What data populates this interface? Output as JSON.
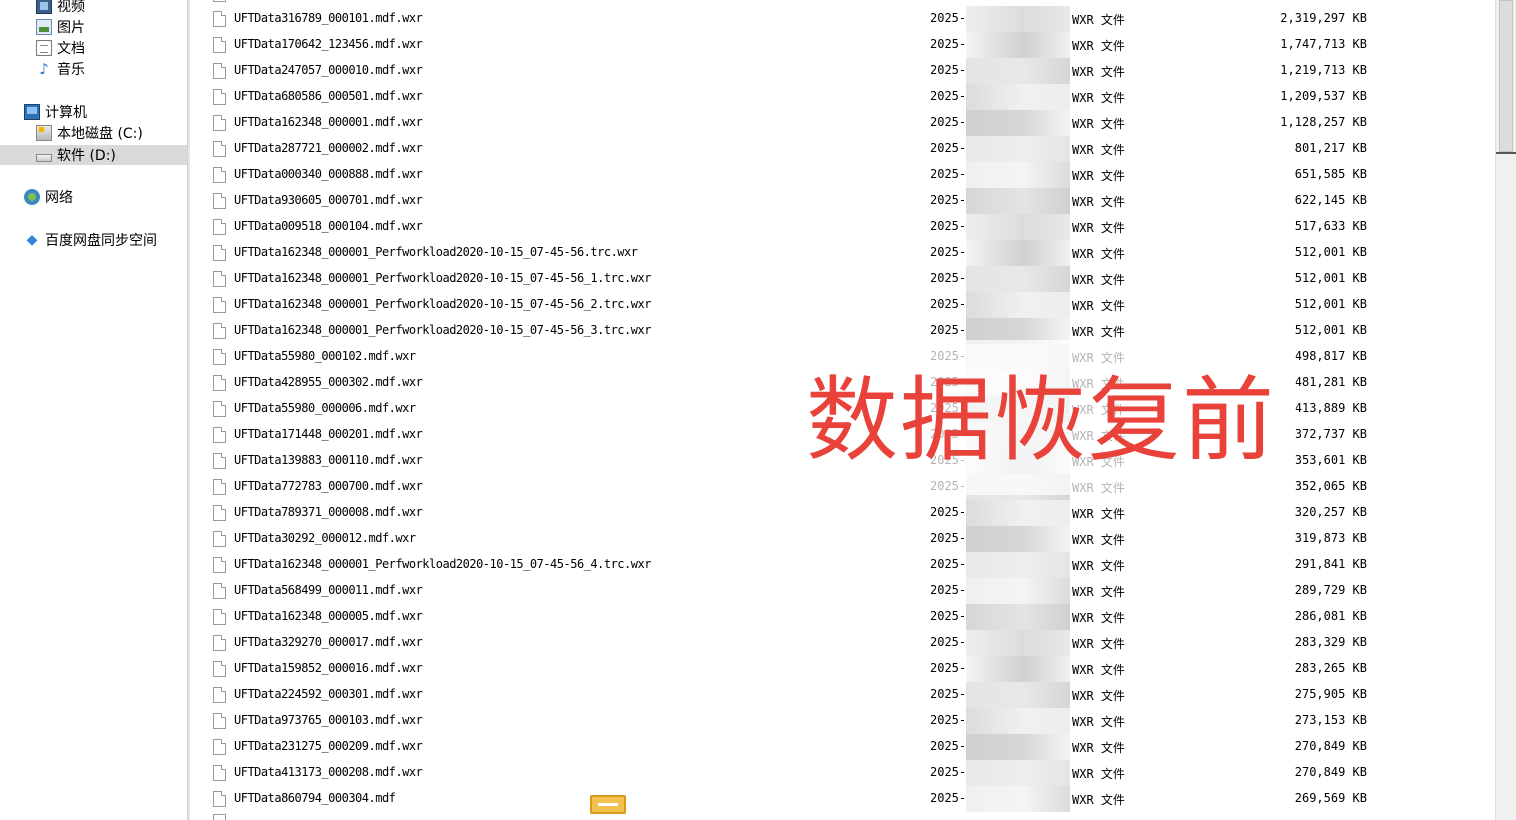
{
  "sidebar": {
    "libraries": [
      {
        "label": "视频",
        "icon": "video-icon"
      },
      {
        "label": "图片",
        "icon": "pictures-icon"
      },
      {
        "label": "文档",
        "icon": "documents-icon"
      },
      {
        "label": "音乐",
        "icon": "music-icon"
      }
    ],
    "computer": {
      "label": "计算机",
      "icon": "computer-icon"
    },
    "drives": [
      {
        "label": "本地磁盘 (C:)",
        "icon": "local-disk-icon"
      },
      {
        "label": "软件 (D:)",
        "icon": "drive-icon",
        "selected": true
      }
    ],
    "network": {
      "label": "网络",
      "icon": "network-icon"
    },
    "baidu": {
      "label": "百度网盘同步空间",
      "icon": "baidu-sync-icon"
    }
  },
  "files": [
    {
      "name": "UFTData316789_000101.mdf.wxr",
      "date": "2025-",
      "type": "WXR 文件",
      "size": "2,319,297 KB"
    },
    {
      "name": "UFTData170642_123456.mdf.wxr",
      "date": "2025-",
      "type": "WXR 文件",
      "size": "1,747,713 KB"
    },
    {
      "name": "UFTData247057_000010.mdf.wxr",
      "date": "2025-",
      "type": "WXR 文件",
      "size": "1,219,713 KB"
    },
    {
      "name": "UFTData680586_000501.mdf.wxr",
      "date": "2025-",
      "type": "WXR 文件",
      "size": "1,209,537 KB"
    },
    {
      "name": "UFTData162348_000001.mdf.wxr",
      "date": "2025-",
      "type": "WXR 文件",
      "size": "1,128,257 KB"
    },
    {
      "name": "UFTData287721_000002.mdf.wxr",
      "date": "2025-",
      "type": "WXR 文件",
      "size": "801,217 KB"
    },
    {
      "name": "UFTData000340_000888.mdf.wxr",
      "date": "2025-",
      "type": "WXR 文件",
      "size": "651,585 KB"
    },
    {
      "name": "UFTData930605_000701.mdf.wxr",
      "date": "2025-",
      "type": "WXR 文件",
      "size": "622,145 KB"
    },
    {
      "name": "UFTData009518_000104.mdf.wxr",
      "date": "2025-",
      "type": "WXR 文件",
      "size": "517,633 KB"
    },
    {
      "name": "UFTData162348_000001_Perfworkload2020-10-15_07-45-56.trc.wxr",
      "date": "2025-",
      "type": "WXR 文件",
      "size": "512,001 KB"
    },
    {
      "name": "UFTData162348_000001_Perfworkload2020-10-15_07-45-56_1.trc.wxr",
      "date": "2025-",
      "type": "WXR 文件",
      "size": "512,001 KB"
    },
    {
      "name": "UFTData162348_000001_Perfworkload2020-10-15_07-45-56_2.trc.wxr",
      "date": "2025-",
      "type": "WXR 文件",
      "size": "512,001 KB"
    },
    {
      "name": "UFTData162348_000001_Perfworkload2020-10-15_07-45-56_3.trc.wxr",
      "date": "2025-",
      "type": "WXR 文件",
      "size": "512,001 KB"
    },
    {
      "name": "UFTData55980_000102.mdf.wxr",
      "date": "2025-",
      "type": "WXR 文件",
      "size": "498,817 KB"
    },
    {
      "name": "UFTData428955_000302.mdf.wxr",
      "date": "2025-",
      "type": "WXR 文件",
      "size": "481,281 KB"
    },
    {
      "name": "UFTData55980_000006.mdf.wxr",
      "date": "2025-",
      "type": "WXR 文件",
      "size": "413,889 KB"
    },
    {
      "name": "UFTData171448_000201.mdf.wxr",
      "date": "2025-",
      "type": "WXR 文件",
      "size": "372,737 KB"
    },
    {
      "name": "UFTData139883_000110.mdf.wxr",
      "date": "2025-",
      "type": "WXR 文件",
      "size": "353,601 KB"
    },
    {
      "name": "UFTData772783_000700.mdf.wxr",
      "date": "2025-",
      "type": "WXR 文件",
      "size": "352,065 KB"
    },
    {
      "name": "UFTData789371_000008.mdf.wxr",
      "date": "2025-",
      "type": "WXR 文件",
      "size": "320,257 KB"
    },
    {
      "name": "UFTData30292_000012.mdf.wxr",
      "date": "2025-",
      "type": "WXR 文件",
      "size": "319,873 KB"
    },
    {
      "name": "UFTData162348_000001_Perfworkload2020-10-15_07-45-56_4.trc.wxr",
      "date": "2025-",
      "type": "WXR 文件",
      "size": "291,841 KB"
    },
    {
      "name": "UFTData568499_000011.mdf.wxr",
      "date": "2025-",
      "type": "WXR 文件",
      "size": "289,729 KB"
    },
    {
      "name": "UFTData162348_000005.mdf.wxr",
      "date": "2025-",
      "type": "WXR 文件",
      "size": "286,081 KB"
    },
    {
      "name": "UFTData329270_000017.mdf.wxr",
      "date": "2025-",
      "type": "WXR 文件",
      "size": "283,329 KB"
    },
    {
      "name": "UFTData159852_000016.mdf.wxr",
      "date": "2025-",
      "type": "WXR 文件",
      "size": "283,265 KB"
    },
    {
      "name": "UFTData224592_000301.mdf.wxr",
      "date": "2025-",
      "type": "WXR 文件",
      "size": "275,905 KB"
    },
    {
      "name": "UFTData973765_000103.mdf.wxr",
      "date": "2025-",
      "type": "WXR 文件",
      "size": "273,153 KB"
    },
    {
      "name": "UFTData231275_000209.mdf.wxr",
      "date": "2025-",
      "type": "WXR 文件",
      "size": "270,849 KB"
    },
    {
      "name": "UFTData413173_000208.mdf.wxr",
      "date": "2025-",
      "type": "WXR 文件",
      "size": "270,849 KB"
    },
    {
      "name": "UFTData860794_000304.mdf",
      "date": "2025-",
      "type": "WXR 文件",
      "size": "269,569 KB"
    }
  ],
  "overlay": {
    "text": "数据恢复前",
    "color": "#e8423a"
  },
  "colors": {
    "selection": "#d9d9d9",
    "redaction": "#d2d2d2"
  }
}
